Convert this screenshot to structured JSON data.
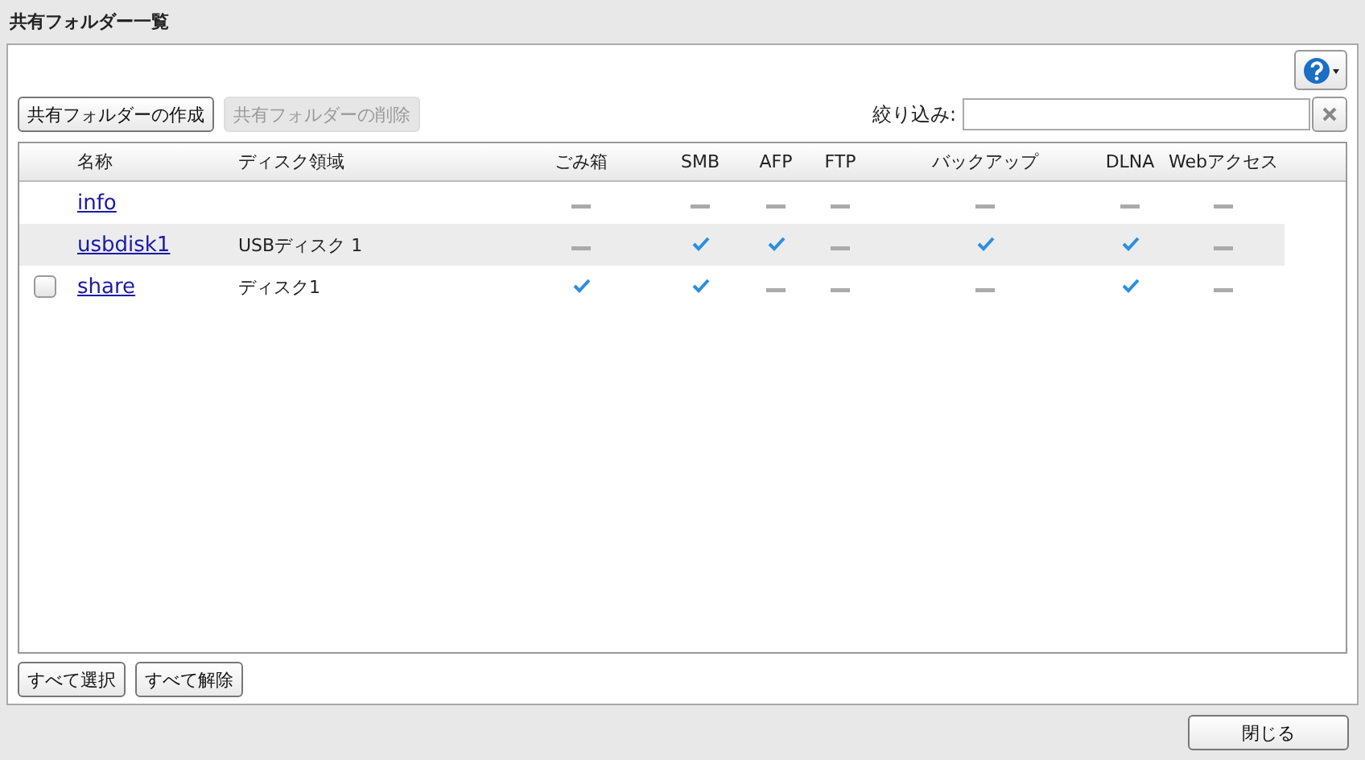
{
  "window": {
    "title": "共有フォルダー一覧"
  },
  "toolbar": {
    "create_button": {
      "label": "共有フォルダーの作成",
      "disabled": false
    },
    "delete_button": {
      "label": "共有フォルダーの削除",
      "disabled": true
    },
    "filter": {
      "label": "絞り込み:"
    }
  },
  "table": {
    "columns": [
      "名称",
      "ディスク領域",
      "ごみ箱",
      "SMB",
      "AFP",
      "FTP",
      "バックアップ",
      "DLNA",
      "Webアクセス"
    ],
    "rows": [
      {
        "name": "info",
        "flags": [
          false,
          false,
          false,
          false,
          false,
          false,
          false
        ],
        "highlighted": false
      },
      {
        "name": "usbdisk1",
        "disk": "USBディスク 1",
        "flags": [
          false,
          true,
          true,
          false,
          true,
          true,
          false
        ],
        "highlighted": true
      },
      {
        "name": "share",
        "disk": "ディスク1",
        "flags": [
          true,
          true,
          false,
          false,
          false,
          true,
          false
        ],
        "highlighted": false,
        "checked": false
      }
    ]
  },
  "footer_buttons": [
    "すべて選択",
    "すべて解除"
  ],
  "close_button": "閉じる"
}
